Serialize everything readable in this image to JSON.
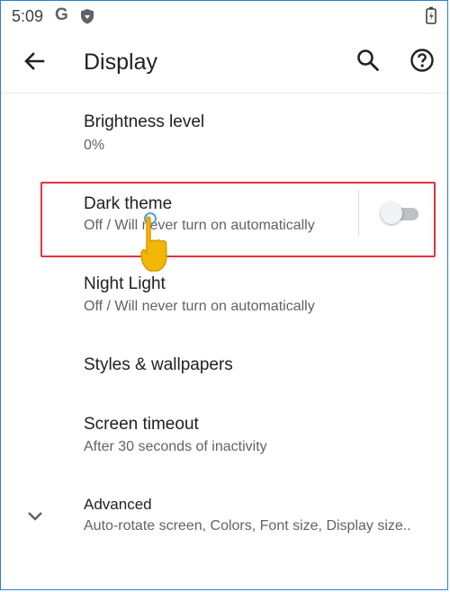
{
  "status_bar": {
    "time": "5:09",
    "g_icon": "G"
  },
  "app_bar": {
    "title": "Display"
  },
  "settings": [
    {
      "title": "Brightness level",
      "subtitle": "0%"
    },
    {
      "title": "Dark theme",
      "subtitle": "Off / Will never turn on automatically",
      "toggle_on": false
    },
    {
      "title": "Night Light",
      "subtitle": "Off / Will never turn on automatically"
    },
    {
      "title": "Styles & wallpapers"
    },
    {
      "title": "Screen timeout",
      "subtitle": "After 30 seconds of inactivity"
    },
    {
      "title": "Advanced",
      "subtitle": "Auto-rotate screen, Colors, Font size, Display size.."
    }
  ],
  "colors": {
    "highlight": "#e0353f",
    "hand": "#f2b705"
  },
  "icons": [
    "shield-icon",
    "battery-icon",
    "back-arrow-icon",
    "search-icon",
    "help-icon",
    "chevron-down-icon",
    "pointing-hand-icon"
  ]
}
